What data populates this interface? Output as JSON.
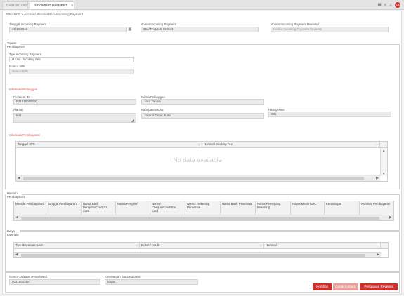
{
  "tabs": {
    "dashboard": "DASHBOARD",
    "incoming": "INCOMING PAYMENT",
    "close": "✕"
  },
  "topbar": {
    "avatar": "CS"
  },
  "breadcrumb": "FINANCE > Account Receivable > Incoming Payment",
  "header": {
    "tanggal_label": "Tanggal Incoming Payment",
    "tanggal_value": "29/10/2018",
    "nomor_label": "Nomor Incoming Payment",
    "nomor_value": "254/IPA/1810-000643",
    "reversal_label": "Nomor Incoming Payment Reversal",
    "reversal_placeholder": "Nomor Incoming Payment Reversal"
  },
  "tujuan": {
    "legend": "Tujuan Pembayaran",
    "tipe_label": "Tipe Incoming Payment",
    "tipe_value": "Unit - Booking Fee",
    "spk_label": "Nomor SPK",
    "spk_placeholder": "Nomor SPK"
  },
  "pelanggan": {
    "title": "Informasi Pelanggan",
    "prospect_label": "Prospect ID",
    "prospect_value": "P21410000000",
    "nama_label": "Nama Pelanggan",
    "nama_value": "Jaka Tarune",
    "alamat_label": "Alamat",
    "alamat_value": "test",
    "kab_label": "Kabupaten/Kota",
    "kab_value": "Jakarta Timur, Kota",
    "hp_label": "Handphone",
    "hp_value": "081"
  },
  "pembayaran": {
    "title": "Informasi Pembayaran",
    "columns": [
      "Tanggal SPK",
      "Nominal Booking Fee"
    ],
    "empty": "No data available"
  },
  "rincian": {
    "legend": "Rincian Pembayaran",
    "columns": [
      "Metode Pembayaran",
      "Tanggal Pembayaran",
      "Nama Bank Pengirim/Credit/D... Card",
      "Nama Pengirim",
      "Nomor Cheque/Credit/De... Card",
      "Nomor Rekening Penerima",
      "Nama Bank Penerima",
      "Nama Pemegang Rekening",
      "Nama Mesin EDC",
      "Keterangan",
      "Nominal Pembayaran"
    ]
  },
  "biaya": {
    "legend": "Biaya Lain-lain",
    "columns": [
      "Tipe Biaya Lain-Lain",
      "Debet / Kredit",
      "Nominal"
    ]
  },
  "footer": {
    "kuitansi_label": "Nomor Kuitansi (Preprinted)",
    "kuitansi_value": "0021500250",
    "keterangan_label": "Keterangan pada Kuitansi",
    "keterangan_value": "bayar",
    "kembali": "Kembali",
    "cetak": "Cetak Kuitansi",
    "pengajuan": "Pengajuan Reversal"
  },
  "colors": {
    "accent_red": "#c9302c",
    "disabled_red": "#e8a09d"
  }
}
